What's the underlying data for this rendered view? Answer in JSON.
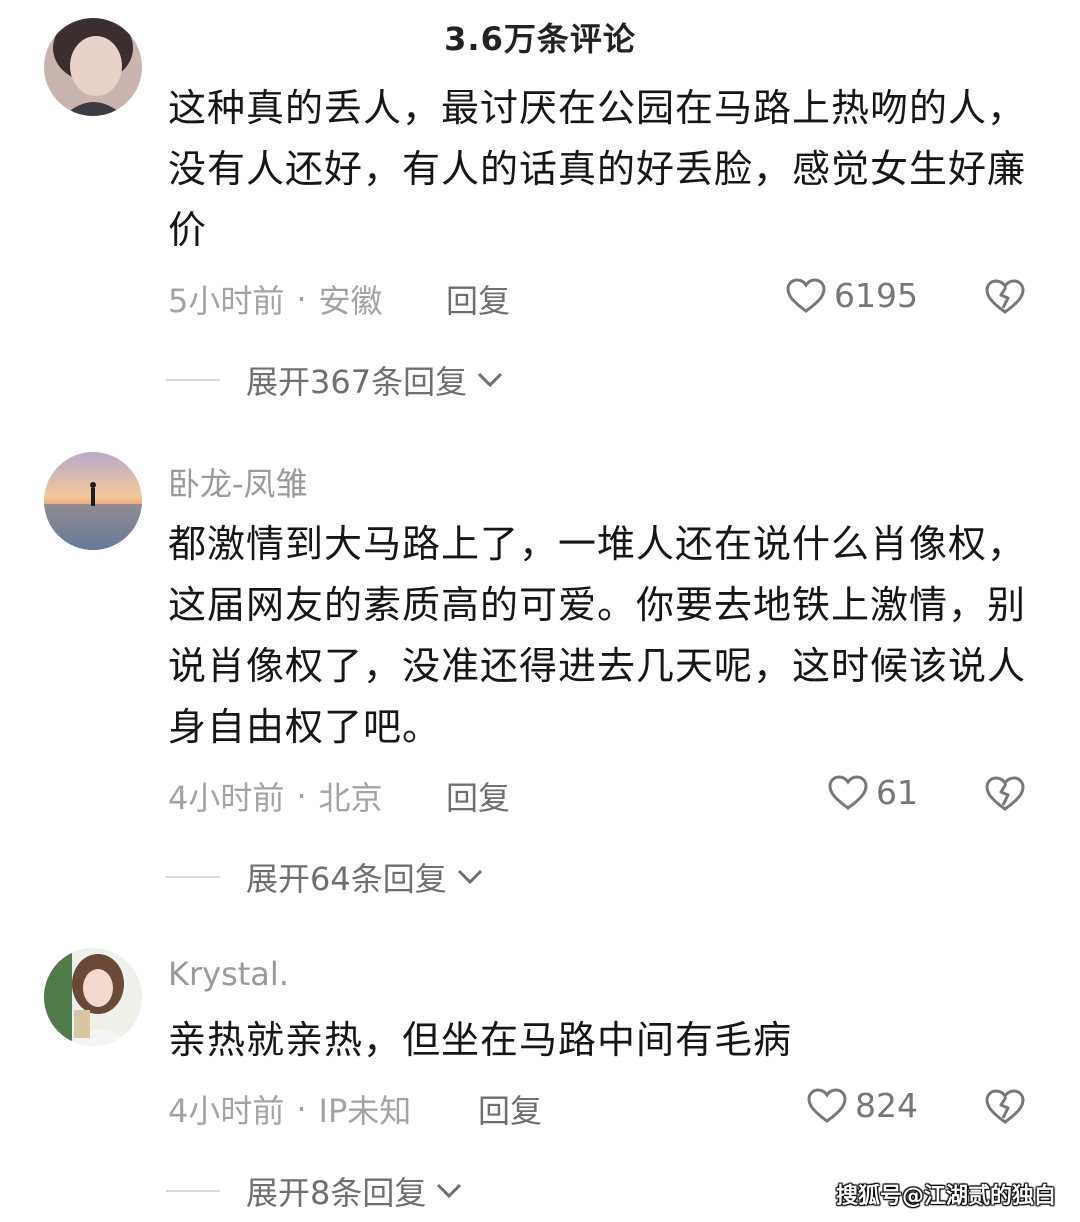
{
  "header": {
    "title": "3.6万条评论"
  },
  "comments": [
    {
      "username": "",
      "text": "这种真的丢人，最讨厌在公园在马路上热吻的人，没有人还好，有人的话真的好丢脸，感觉女生好廉价",
      "time": "5小时前",
      "location": "安徽",
      "reply_label": "回复",
      "likes": "6195",
      "expand_label": "展开367条回复"
    },
    {
      "username": "卧龙-凤雏",
      "text": "都激情到大马路上了，一堆人还在说什么肖像权，这届网友的素质高的可爱。你要去地铁上激情，别说肖像权了，没准还得进去几天呢，这时候该说人身自由权了吧。",
      "time": "4小时前",
      "location": "北京",
      "reply_label": "回复",
      "likes": "61",
      "expand_label": "展开64条回复"
    },
    {
      "username": "Krystal.",
      "text": "亲热就亲热，但坐在马路中间有毛病",
      "time": "4小时前",
      "location": "IP未知",
      "reply_label": "回复",
      "likes": "824",
      "expand_label": "展开8条回复"
    }
  ],
  "separator": "·",
  "icons": {
    "like": "heart-outline-icon",
    "dislike": "broken-heart-icon",
    "expand": "chevron-down-icon"
  },
  "watermark": "搜狐号@江湖贰的独白"
}
